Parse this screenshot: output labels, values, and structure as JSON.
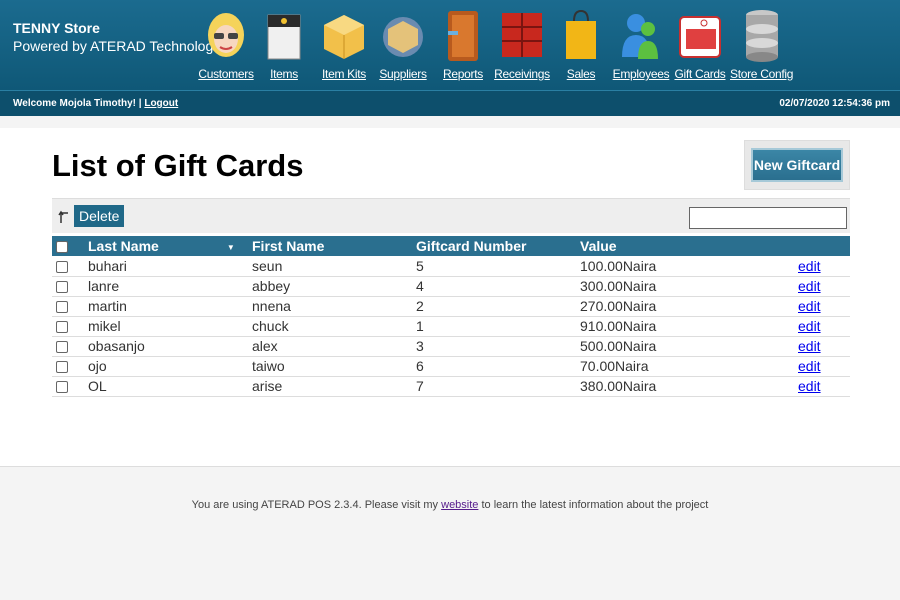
{
  "store": {
    "name": "TENNY Store",
    "powered_by": "Powered by ATERAD Technologies"
  },
  "menu": [
    {
      "label": "Customers",
      "icon": "customers-icon"
    },
    {
      "label": "Items",
      "icon": "items-icon"
    },
    {
      "label": "Item Kits",
      "icon": "item-kits-icon"
    },
    {
      "label": "Suppliers",
      "icon": "suppliers-icon"
    },
    {
      "label": "Reports",
      "icon": "reports-icon"
    },
    {
      "label": "Receivings",
      "icon": "receivings-icon"
    },
    {
      "label": "Sales",
      "icon": "sales-icon"
    },
    {
      "label": "Employees",
      "icon": "employees-icon"
    },
    {
      "label": "Gift Cards",
      "icon": "gift-cards-icon"
    },
    {
      "label": "Store Config",
      "icon": "store-config-icon"
    }
  ],
  "welcome": {
    "text": "Welcome Mojola Timothy! |",
    "logout": "Logout",
    "datetime": "02/07/2020 12:54:36 pm"
  },
  "page": {
    "title": "List of Gift Cards",
    "new_button": "New Giftcard",
    "delete_button": "Delete",
    "search_value": ""
  },
  "table": {
    "headers": {
      "last_name": "Last Name",
      "first_name": "First Name",
      "number": "Giftcard Number",
      "value": "Value"
    },
    "rows": [
      {
        "last": "buhari",
        "first": "seun",
        "number": "5",
        "value": "100.00Naira",
        "edit": "edit"
      },
      {
        "last": "lanre",
        "first": "abbey",
        "number": "4",
        "value": "300.00Naira",
        "edit": "edit"
      },
      {
        "last": "martin",
        "first": "nnena",
        "number": "2",
        "value": "270.00Naira",
        "edit": "edit"
      },
      {
        "last": "mikel",
        "first": "chuck",
        "number": "1",
        "value": "910.00Naira",
        "edit": "edit"
      },
      {
        "last": "obasanjo",
        "first": "alex",
        "number": "3",
        "value": "500.00Naira",
        "edit": "edit"
      },
      {
        "last": "ojo",
        "first": "taiwo",
        "number": "6",
        "value": "70.00Naira",
        "edit": "edit"
      },
      {
        "last": "OL",
        "first": "arise",
        "number": "7",
        "value": "380.00Naira",
        "edit": "edit"
      }
    ]
  },
  "footer": {
    "before": "You are using ATERAD POS 2.3.4. Please visit my",
    "link": "website",
    "after": "to learn the latest information about the project"
  }
}
